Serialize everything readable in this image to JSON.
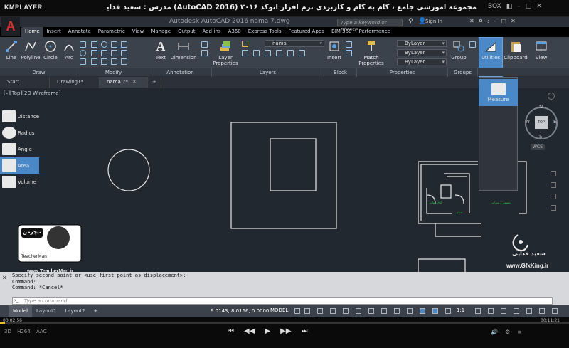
{
  "player": {
    "logo": "KMPLAYER",
    "title": "مجموعه آموزشی جامع ، گام به گام و کاربردی نرم افزار اتوکد ۲۰۱۶ (AutoCAD 2016) مدرس : سعید فدایی (تیچرمن) گروه آموزشی پادشاه گرافیست ها",
    "box_label": "BOX",
    "controls": [
      "◧",
      "–",
      "□",
      "✕"
    ],
    "time_elapsed": "00:02:56",
    "time_total": "00:11:21",
    "progress": 0.009,
    "transport": [
      "⏮",
      "◀◀",
      "▶",
      "▶▶",
      "⏭"
    ],
    "badges": [
      "3D",
      "H264",
      "AAC"
    ],
    "right_icons": [
      "🔊",
      "⚙",
      "≡"
    ]
  },
  "app": {
    "logo": "A",
    "doc_title": "Autodesk AutoCAD 2016   nama 7.dwg",
    "search_placeholder": "Type a keyword or phrase",
    "signin": "Sign In",
    "top_icons": [
      "✕",
      "A",
      "?",
      "–",
      "□",
      "✕"
    ]
  },
  "ribbon": {
    "tabs": [
      "Home",
      "Insert",
      "Annotate",
      "Parametric",
      "View",
      "Manage",
      "Output",
      "Add-ins",
      "A360",
      "Express Tools",
      "Featured Apps",
      "BIM 360",
      "Performance"
    ],
    "active_tab": "Home",
    "draw_tools": [
      "Line",
      "Polyline",
      "Circle",
      "Arc"
    ],
    "annotation_tools": [
      "Text",
      "Dimension"
    ],
    "layer_tool": "Layer Properties",
    "layer_name": "nama",
    "insert_tool": "Insert",
    "match_tool": "Match Properties",
    "bylayer": [
      "ByLayer",
      "ByLayer",
      "ByLayer"
    ],
    "group_tool": "Group",
    "utilities_tool": "Utilities",
    "clipboard_tool": "Clipboard",
    "view_tool": "View",
    "panels": [
      "Draw",
      "Modify",
      "Annotation",
      "Layers",
      "Block",
      "Properties",
      "Groups"
    ]
  },
  "file_tabs": [
    {
      "label": "Start",
      "active": false
    },
    {
      "label": "Drawing1*",
      "active": false
    },
    {
      "label": "nama 7*",
      "active": true
    }
  ],
  "viewport_label": "[–][Top][2D Wireframe]",
  "measure_menu": {
    "items": [
      "Measure",
      "Distance",
      "Radius",
      "Angle",
      "Area",
      "Volume"
    ],
    "highlighted": [
      "Measure",
      "Area"
    ]
  },
  "viewcube": {
    "top": "TOP",
    "north": "N",
    "south": "S",
    "east": "E",
    "west": "W",
    "wcs": "WCS"
  },
  "room_labels": [
    "اتاق خواب",
    "حمام",
    "نشیمن و پذیرایی"
  ],
  "watermark": {
    "left_url": "www.TeacherMan.ir",
    "right_name": "سعید فدایی",
    "right_url": "www.GfxKing.ir",
    "badge_title": "تیچرمن",
    "badge_sub": "TeacherMan"
  },
  "command": {
    "history": [
      "Specify second point or <use first point as displacement>:",
      "Command:",
      "Command: *Cancel*"
    ],
    "placeholder": "Type a command"
  },
  "status": {
    "tabs": [
      "Model",
      "Layout1",
      "Layout2"
    ],
    "active_tab": "Model",
    "plus": "+",
    "coords": "9.0143, 8.0166, 0.0000",
    "mode": "MODEL",
    "scale": "1:1"
  },
  "colors": {
    "canvas": "#212830",
    "ribbon": "#3c424c",
    "accent": "#4a88c8",
    "line": "#e8e8e8",
    "green_text": "#2ecc40"
  }
}
